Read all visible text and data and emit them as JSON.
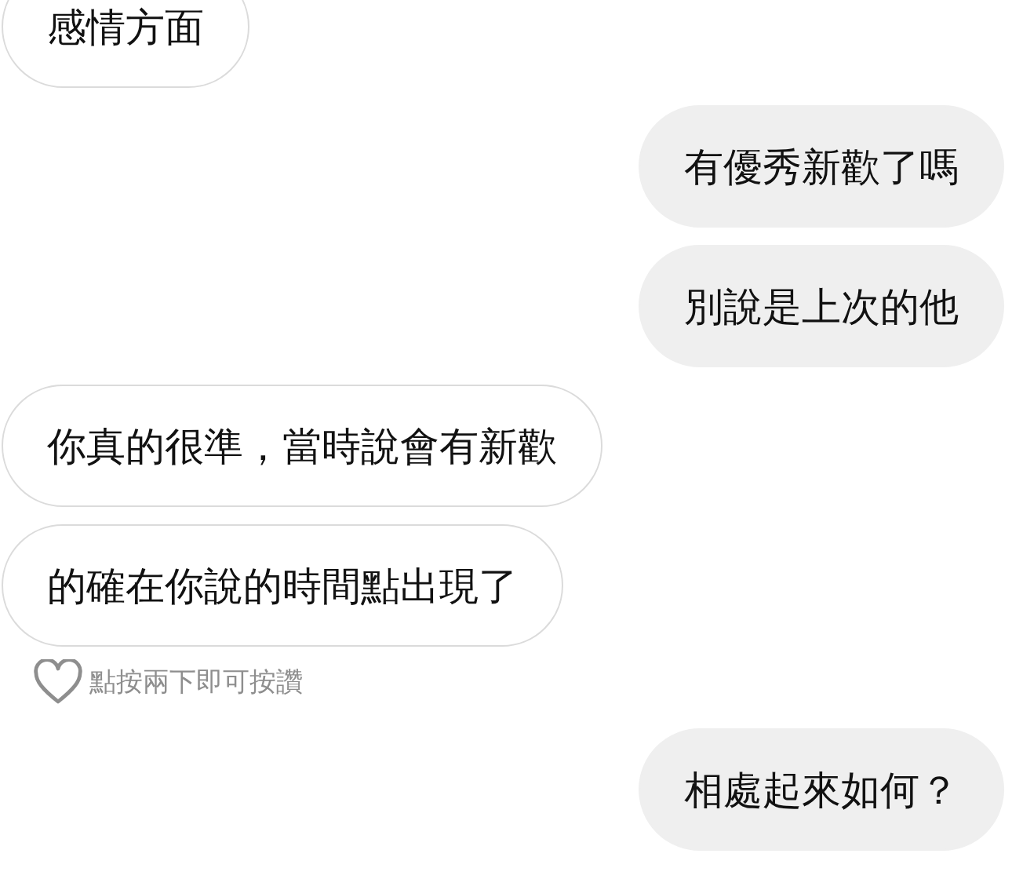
{
  "messages": [
    {
      "kind": "incoming",
      "text": "感情方面"
    },
    {
      "kind": "outgoing",
      "text": "有優秀新歡了嗎"
    },
    {
      "kind": "outgoing",
      "text": "別說是上次的他"
    },
    {
      "kind": "incoming",
      "text": "你真的很準，當時說會有新歡"
    },
    {
      "kind": "incoming",
      "text": "的確在你說的時間點出現了"
    },
    {
      "kind": "like_hint",
      "text": "點按兩下即可按讚"
    },
    {
      "kind": "outgoing",
      "text": "相處起來如何？"
    }
  ]
}
